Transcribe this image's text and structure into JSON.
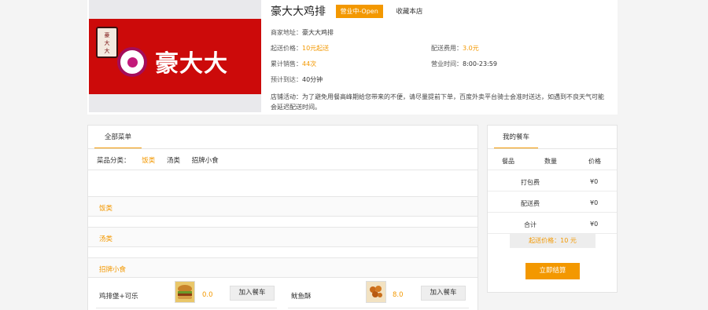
{
  "store": {
    "name": "豪大大鸡排",
    "status_badge": "营业中-Open",
    "favorite_label": "收藏本店",
    "banner_brand": "豪大大",
    "banner_seal": "豪大大",
    "address_label": "商家地址：",
    "address_value": "豪大大鸡排",
    "min_order_label": "起送价格：",
    "min_order_value": "10元起送",
    "delivery_fee_label": "配送费用：",
    "delivery_fee_value": "3.0元",
    "sales_label": "累计销售：",
    "sales_value": "44次",
    "hours_label": "营业时间：",
    "hours_value": "8:00-23:59",
    "eta_label": "预计到达：",
    "eta_value": "40分钟",
    "activity": "店铺活动：为了避免用餐高峰期给您带来的不便，请尽量提前下单，百度外卖平台骑士会准时送达，如遇到不良天气可能会延迟配送时间。"
  },
  "menu": {
    "tab_label": "全部菜单",
    "categories_label": "菜品分类：",
    "categories": [
      "饭类",
      "汤类",
      "招牌小食"
    ],
    "sections": [
      "饭类",
      "汤类",
      "招牌小食"
    ],
    "dishes": [
      {
        "name": "鸡排堡+可乐",
        "price": "0.0",
        "add_label": "加入餐车"
      },
      {
        "name": "鱿鱼酥",
        "price": "8.0",
        "add_label": "加入餐车"
      }
    ]
  },
  "cart": {
    "tab_label": "我的餐车",
    "headers": [
      "餐品",
      "数量",
      "价格"
    ],
    "rows": [
      {
        "label": "打包费",
        "value": "¥0"
      },
      {
        "label": "配送费",
        "value": "¥0"
      },
      {
        "label": "合计",
        "value": "¥0"
      }
    ],
    "min_order_notice": "起送价格：10 元",
    "checkout_label": "立即结算"
  },
  "colors": {
    "accent": "#f39800",
    "banner_red": "#cc0a0a"
  }
}
